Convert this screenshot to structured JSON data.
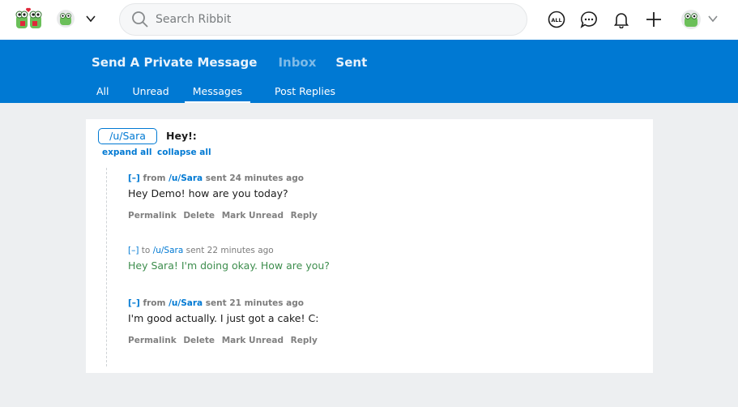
{
  "app": {
    "logo_icon": "ribbit-frog-logo-icon",
    "search_placeholder": "Search Ribbit",
    "brand_color": "#0079d3"
  },
  "topbar_icons": [
    "frog-avatar-icon",
    "chevron-down-icon",
    "search-icon",
    "all-icon",
    "chat-icon",
    "bell-icon",
    "plus-icon",
    "user-avatar-icon",
    "chevron-down-icon"
  ],
  "all_icon_text": "ALL",
  "header": {
    "links": [
      "Send A Private Message",
      "Inbox",
      "Sent"
    ],
    "tabs": [
      "All",
      "Unread",
      "Messages",
      "Post Replies"
    ],
    "active_tab": "Messages"
  },
  "thread": {
    "user": "/u/Sara",
    "subject": "Hey!:",
    "expand_all": "expand all",
    "collapse_all": "collapse all",
    "messages": [
      {
        "toggle": "[–]",
        "direction": "from",
        "user": "/u/Sara",
        "time": "sent 24 minutes ago",
        "text": "Hey Demo! how are you today?",
        "actions": [
          "Permalink",
          "Delete",
          "Mark Unread",
          "Reply"
        ]
      },
      {
        "toggle": "[–]",
        "direction": "to",
        "user": "/u/Sara",
        "time": "sent 22 minutes ago",
        "text": "Hey Sara! I'm doing okay. How are you?"
      },
      {
        "toggle": "[–]",
        "direction": "from",
        "user": "/u/Sara",
        "time": "sent 21 minutes ago",
        "text": "I'm good actually. I just got a cake! C:",
        "actions": [
          "Permalink",
          "Delete",
          "Mark Unread",
          "Reply"
        ]
      }
    ]
  }
}
